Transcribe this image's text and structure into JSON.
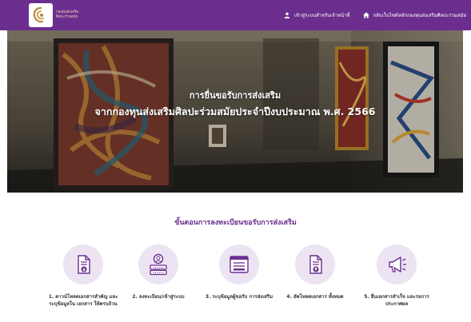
{
  "header": {
    "logo_line1": "กองทุนส่งเสริม",
    "logo_line2": "ศิลปะร่วมสมัย",
    "nav": [
      {
        "label": "เข้าสู่ระบบสำหรับเจ้าหน้าที่",
        "icon": "user-icon"
      },
      {
        "label": "กลับเว็บไซต์หลักกองทุนส่งเสริมศิลปะร่วมสมัย",
        "icon": "home-icon"
      }
    ]
  },
  "hero": {
    "title_line1": "การยื่นขอรับการส่งเสริม",
    "title_line2": "จากกองทุนส่งเสริมศิลปะร่วมสมัยประจำปีงบประมาณ พ.ศ. 2566"
  },
  "steps": {
    "title": "ขั้นตอนการลงทะเบียนขอรับการส่งเสริม",
    "items": [
      {
        "icon": "document-download-icon",
        "label": "1. ดาวน์โหลดเอกสารสำคัญ และระบุข้อมูลใน เอกสาร ให้ครบถ้วน"
      },
      {
        "icon": "user-login-icon",
        "label": "2. ลงทะเบียน/เข้าสู่ระบบ"
      },
      {
        "icon": "form-icon",
        "label": "3. ระบุข้อมูลผู้ขอรับ การส่งเสริม"
      },
      {
        "icon": "document-upload-icon",
        "label": "4. อัพโหลดเอกสาร ทั้งหมด"
      },
      {
        "icon": "megaphone-icon",
        "label": "5. ยื่นเอกสารสำเร็จ และรอการประกาศผล"
      }
    ]
  },
  "colors": {
    "brand_purple": "#6b2e8f",
    "icon_circle": "#ece4f2",
    "icon_stroke": "#6b2e8f"
  }
}
